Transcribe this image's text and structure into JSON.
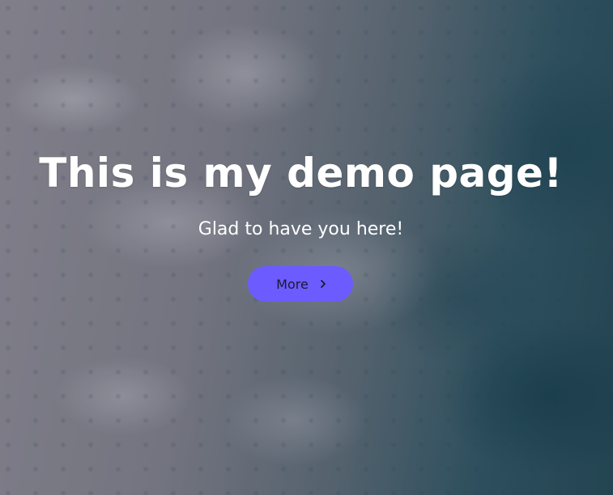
{
  "hero": {
    "title": "This is my demo page!",
    "subtitle": "Glad to have you here!",
    "button_label": "More",
    "button_icon": "chevron-right-icon",
    "button_color": "#6c5cff",
    "background": "ocean-waves-aerial-image"
  }
}
